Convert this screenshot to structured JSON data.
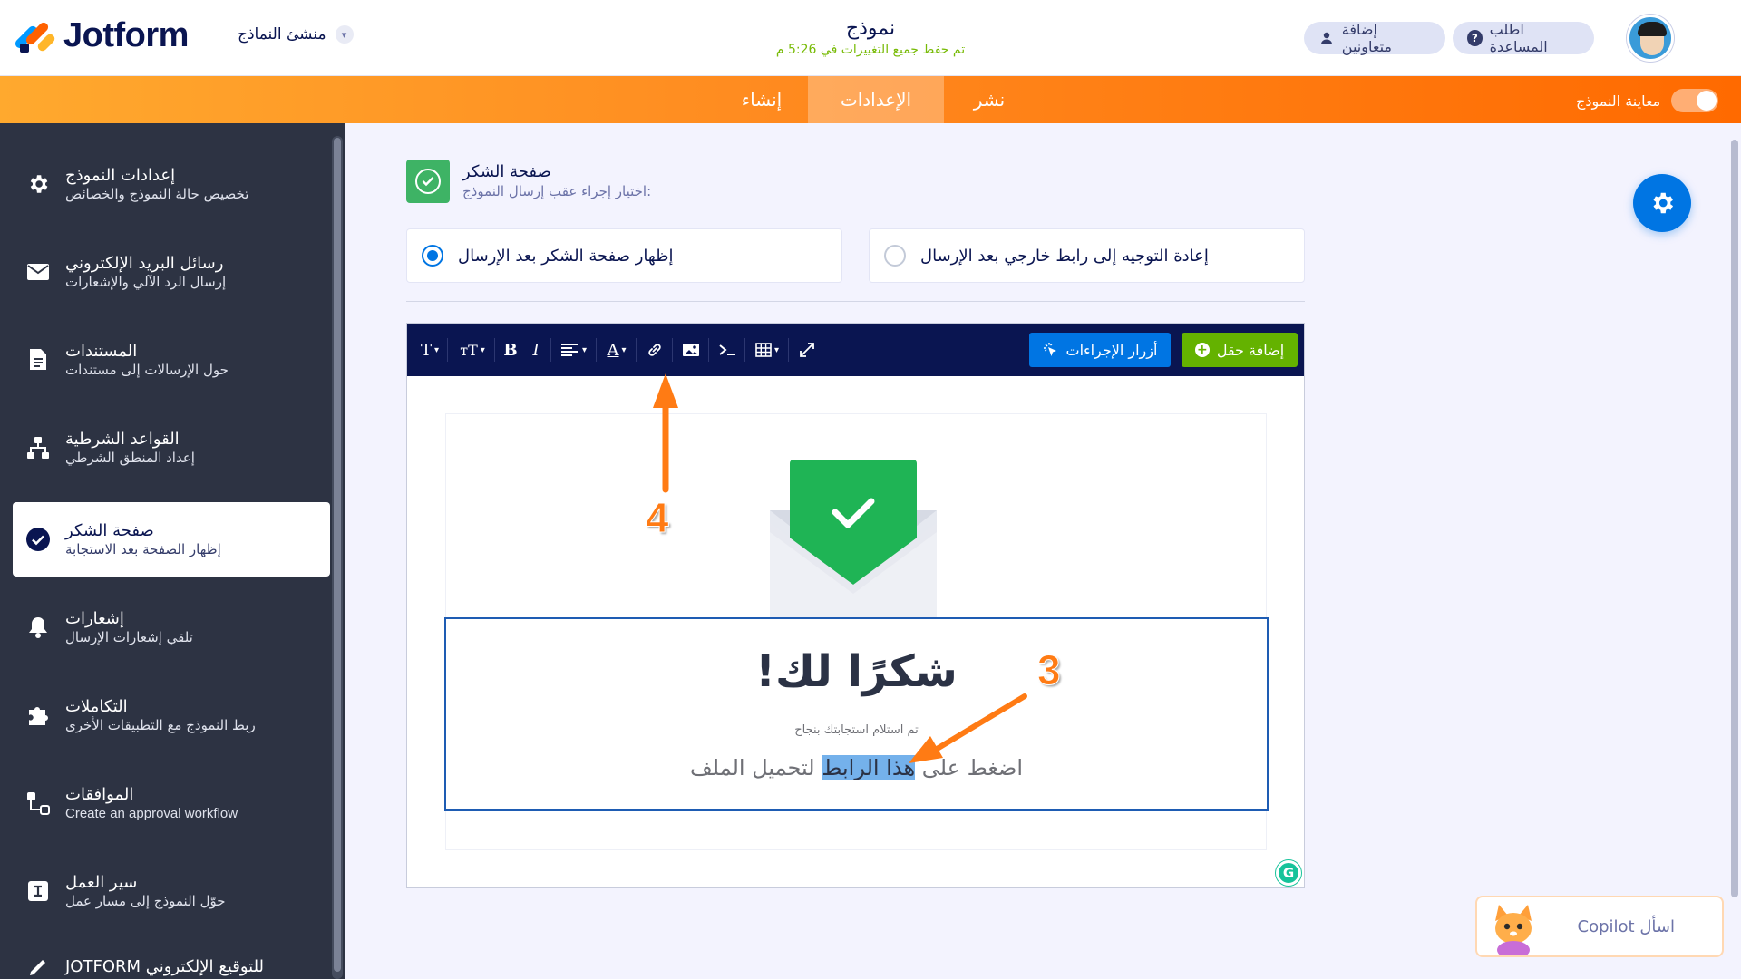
{
  "header": {
    "logo_text": "Jotform",
    "form_builder": "منشئ النماذج",
    "form_title": "نموذج",
    "saved_status": "تم حفظ جميع التغييرات في 5:26 م",
    "help_label": "اطلب المساعدة",
    "collab_label": "إضافة متعاونين"
  },
  "nav": {
    "tabs": [
      {
        "label": "إنشاء"
      },
      {
        "label": "الإعدادات"
      },
      {
        "label": "نشر"
      }
    ],
    "active_tab": "الإعدادات",
    "preview_label": "معاينة النموذج"
  },
  "sidebar": {
    "items": [
      {
        "title": "إعدادات النموذج",
        "subtitle": "تخصيص حالة النموذج والخصائص",
        "icon": "gear-icon"
      },
      {
        "title": "رسائل البريد الإلكتروني",
        "subtitle": "إرسال الرد الآلي والإشعارات",
        "icon": "envelope-icon"
      },
      {
        "title": "المستندات",
        "subtitle": "حول الإرسالات إلى مستندات",
        "icon": "document-icon"
      },
      {
        "title": "القواعد الشرطية",
        "subtitle": "إعداد المنطق الشرطي",
        "icon": "logic-icon"
      },
      {
        "title": "صفحة الشكر",
        "subtitle": "إظهار الصفحة بعد الاستجابة",
        "icon": "check-circle-icon",
        "active": true
      },
      {
        "title": "إشعارات",
        "subtitle": "تلقي إشعارات الإرسال",
        "icon": "bell-icon"
      },
      {
        "title": "التكاملات",
        "subtitle": "ربط النموذج مع التطبيقات الأخرى",
        "icon": "puzzle-icon"
      },
      {
        "title": "الموافقات",
        "subtitle": "Create an approval workflow",
        "icon": "approval-icon"
      },
      {
        "title": "سير العمل",
        "subtitle": "حوّل النموذج إلى مسار عمل",
        "icon": "workflow-icon"
      },
      {
        "title": "JOTFORM للتوقيع الإلكتروني",
        "subtitle": "",
        "icon": "sign-icon"
      }
    ]
  },
  "thankyou": {
    "section_title": "صفحة الشكر",
    "section_sub": "اختيار إجراء عقب إرسال النموذج:",
    "option_show": "إظهار صفحة الشكر بعد الإرسال",
    "option_redirect": "إعادة التوجيه إلى رابط خارجي بعد الإرسال",
    "selected": "show"
  },
  "toolbar": {
    "add_field": "إضافة حقل",
    "action_buttons": "أزرار الإجراءات",
    "text_btn": "T",
    "size_btn": "тT",
    "bold_btn": "B",
    "italic_btn": "I",
    "font_color_btn": "A"
  },
  "content": {
    "title": "!شكرًا لك",
    "subtitle": "تم استلام استجابتك بنجاح",
    "link_before": "اضغط على ",
    "link_highlight": "هذا الرابط",
    "link_after": " لتحميل الملف"
  },
  "copilot": {
    "label": "اسأل Copilot"
  },
  "annotations": {
    "step3": "3",
    "step4": "4",
    "arrow_color": "#ff7b14"
  },
  "colors": {
    "accent_orange": "#ff6a00",
    "blue": "#0075e3",
    "green": "#64b200",
    "sidebar_bg": "#2d3343",
    "toolbar_bg": "#0a1551"
  }
}
